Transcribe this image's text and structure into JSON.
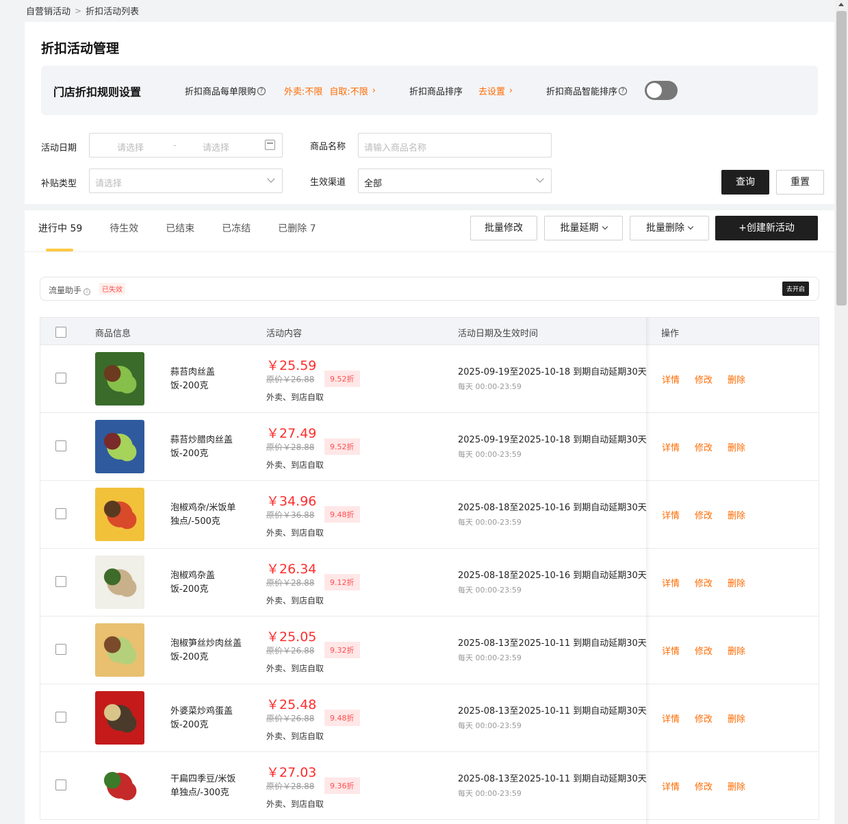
{
  "breadcrumb": {
    "root": "自营销活动",
    "current": "折扣活动列表"
  },
  "page_title": "折扣活动管理",
  "rules": {
    "title": "门店折扣规则设置",
    "limit_label": "折扣商品每单限购",
    "limit_delivery": "外卖:不限",
    "limit_pickup": "自取:不限",
    "sort_label": "折扣商品排序",
    "sort_action": "去设置",
    "smart_sort_label": "折扣商品智能排序",
    "smart_sort_on": false
  },
  "filters": {
    "date_label": "活动日期",
    "date_start_ph": "请选择",
    "date_sep": "-",
    "date_end_ph": "请选择",
    "name_label": "商品名称",
    "name_ph": "请输入商品名称",
    "subsidy_label": "补贴类型",
    "subsidy_ph": "请选择",
    "channel_label": "生效渠道",
    "channel_value": "全部",
    "query_btn": "查询",
    "reset_btn": "重置"
  },
  "tabs": [
    "进行中 59",
    "待生效",
    "已结束",
    "已冻结",
    "已删除 7"
  ],
  "actions": {
    "batch_edit": "批量修改",
    "batch_extend": "批量延期",
    "batch_delete": "批量删除",
    "create": "+创建新活动"
  },
  "traffic": {
    "label": "流量助手",
    "info": "i",
    "badge": "已失效",
    "open": "去开启"
  },
  "table": {
    "headers": [
      "商品信息",
      "活动内容",
      "活动日期及生效时间",
      "操作"
    ],
    "ops": [
      "详情",
      "修改",
      "删除"
    ],
    "rows": [
      {
        "name": "蒜苔肉丝盖饭-200克",
        "price": "￥25.59",
        "orig": "原价￥26.88",
        "disc": "9.52折",
        "chan": "外卖、到店自取",
        "dates": "2025-09-19至2025-10-18 到期自动延期30天",
        "daily": "每天 00:00-23:59"
      },
      {
        "name": "蒜苔炒腊肉丝盖饭-200克",
        "price": "￥27.49",
        "orig": "原价￥28.88",
        "disc": "9.52折",
        "chan": "外卖、到店自取",
        "dates": "2025-09-19至2025-10-18 到期自动延期30天",
        "daily": "每天 00:00-23:59"
      },
      {
        "name": "泡椒鸡杂/米饭单独点/-500克",
        "price": "￥34.96",
        "orig": "原价￥36.88",
        "disc": "9.48折",
        "chan": "外卖、到店自取",
        "dates": "2025-08-18至2025-10-16 到期自动延期30天",
        "daily": "每天 00:00-23:59"
      },
      {
        "name": "泡椒鸡杂盖饭-200克",
        "price": "￥26.34",
        "orig": "原价￥28.88",
        "disc": "9.12折",
        "chan": "外卖、到店自取",
        "dates": "2025-08-18至2025-10-16 到期自动延期30天",
        "daily": "每天 00:00-23:59"
      },
      {
        "name": "泡椒笋丝炒肉丝盖饭-200克",
        "price": "￥25.05",
        "orig": "原价￥26.88",
        "disc": "9.32折",
        "chan": "外卖、到店自取",
        "dates": "2025-08-13至2025-10-11 到期自动延期30天",
        "daily": "每天 00:00-23:59"
      },
      {
        "name": "外婆菜炒鸡蛋盖饭-200克",
        "price": "￥25.48",
        "orig": "原价￥26.88",
        "disc": "9.48折",
        "chan": "外卖、到店自取",
        "dates": "2025-08-13至2025-10-11 到期自动延期30天",
        "daily": "每天 00:00-23:59"
      },
      {
        "name": "干扁四季豆/米饭单独点/-300克",
        "price": "￥27.03",
        "orig": "原价￥28.88",
        "disc": "9.36折",
        "chan": "外卖、到店自取",
        "dates": "2025-08-13至2025-10-11 到期自动延期30天",
        "daily": "每天 00:00-23:59"
      }
    ]
  },
  "colors": {
    "accent": "#ff6a00",
    "price": "#ff2d2d",
    "dark_button": "#1f1f1f",
    "tab_indicator": "#ffc940"
  }
}
